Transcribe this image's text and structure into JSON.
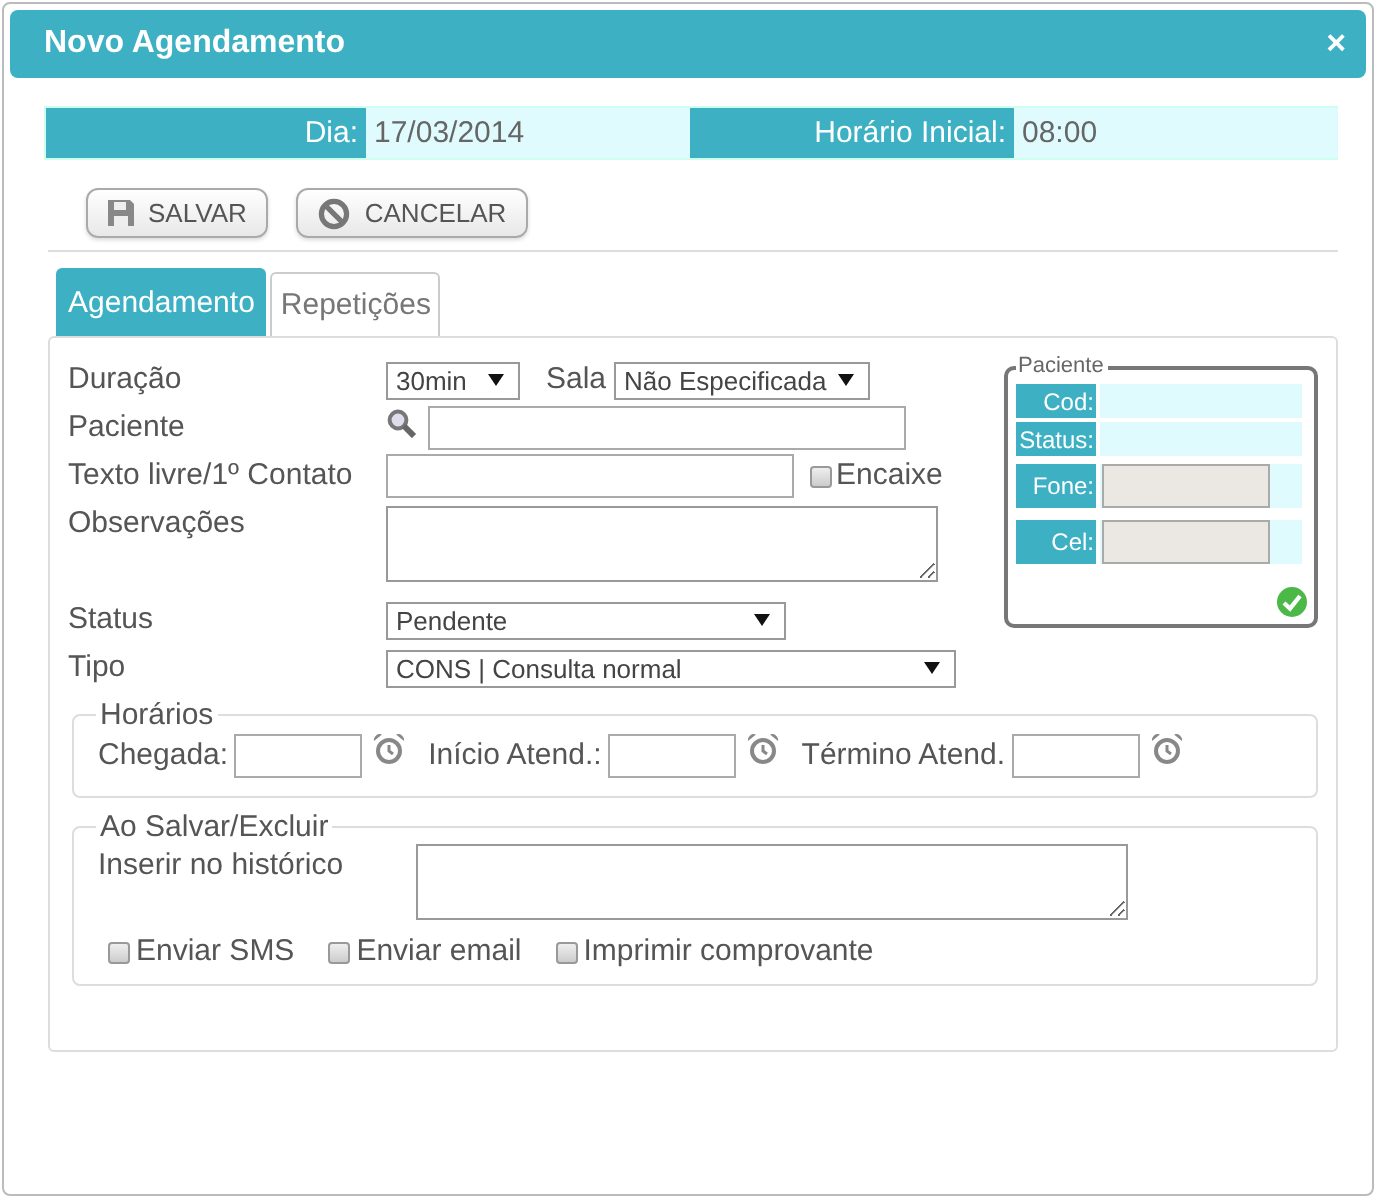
{
  "window": {
    "title": "Novo Agendamento",
    "close": "×"
  },
  "info": [
    {
      "label": "Dia:",
      "value": "17/03/2014"
    },
    {
      "label": "Horário Inicial:",
      "value": "08:00"
    }
  ],
  "buttons": [
    {
      "label": "SALVAR",
      "kind": "save"
    },
    {
      "label": "CANCELAR",
      "kind": "cancel"
    }
  ],
  "tabs": [
    {
      "label": "Agendamento",
      "selected": true
    },
    {
      "label": "Repetições",
      "selected": false
    }
  ],
  "form": {
    "duracao": {
      "label": "Duração",
      "value": "30min"
    },
    "sala": {
      "label": "Sala",
      "value": "Não Especificada"
    },
    "paciente": {
      "label": "Paciente"
    },
    "texto": {
      "label": "Texto livre/1º Contato"
    },
    "encaixe": {
      "label": "Encaixe",
      "checked": false
    },
    "observacoes": {
      "label": "Observações"
    },
    "status": {
      "label": "Status",
      "value": "Pendente"
    },
    "tipo": {
      "label": "Tipo",
      "value": "CONS | Consulta normal"
    }
  },
  "patient_box": {
    "legend": "Paciente",
    "rows": [
      {
        "label": "Cod:",
        "kind": "text"
      },
      {
        "label": "Status:",
        "kind": "text"
      },
      {
        "label": "Fone:",
        "kind": "input"
      },
      {
        "label": "Cel:",
        "kind": "input"
      }
    ]
  },
  "horarios": {
    "legend": "Horários",
    "fields": [
      {
        "label": "Chegada:"
      },
      {
        "label": "Início Atend.:"
      },
      {
        "label": "Término Atend."
      }
    ]
  },
  "ao_salvar": {
    "legend": "Ao Salvar/Excluir",
    "historico_label": "Inserir no histórico",
    "options": [
      {
        "label": "Enviar SMS",
        "checked": false
      },
      {
        "label": "Enviar email",
        "checked": false
      },
      {
        "label": "Imprimir comprovante",
        "checked": false
      }
    ]
  }
}
